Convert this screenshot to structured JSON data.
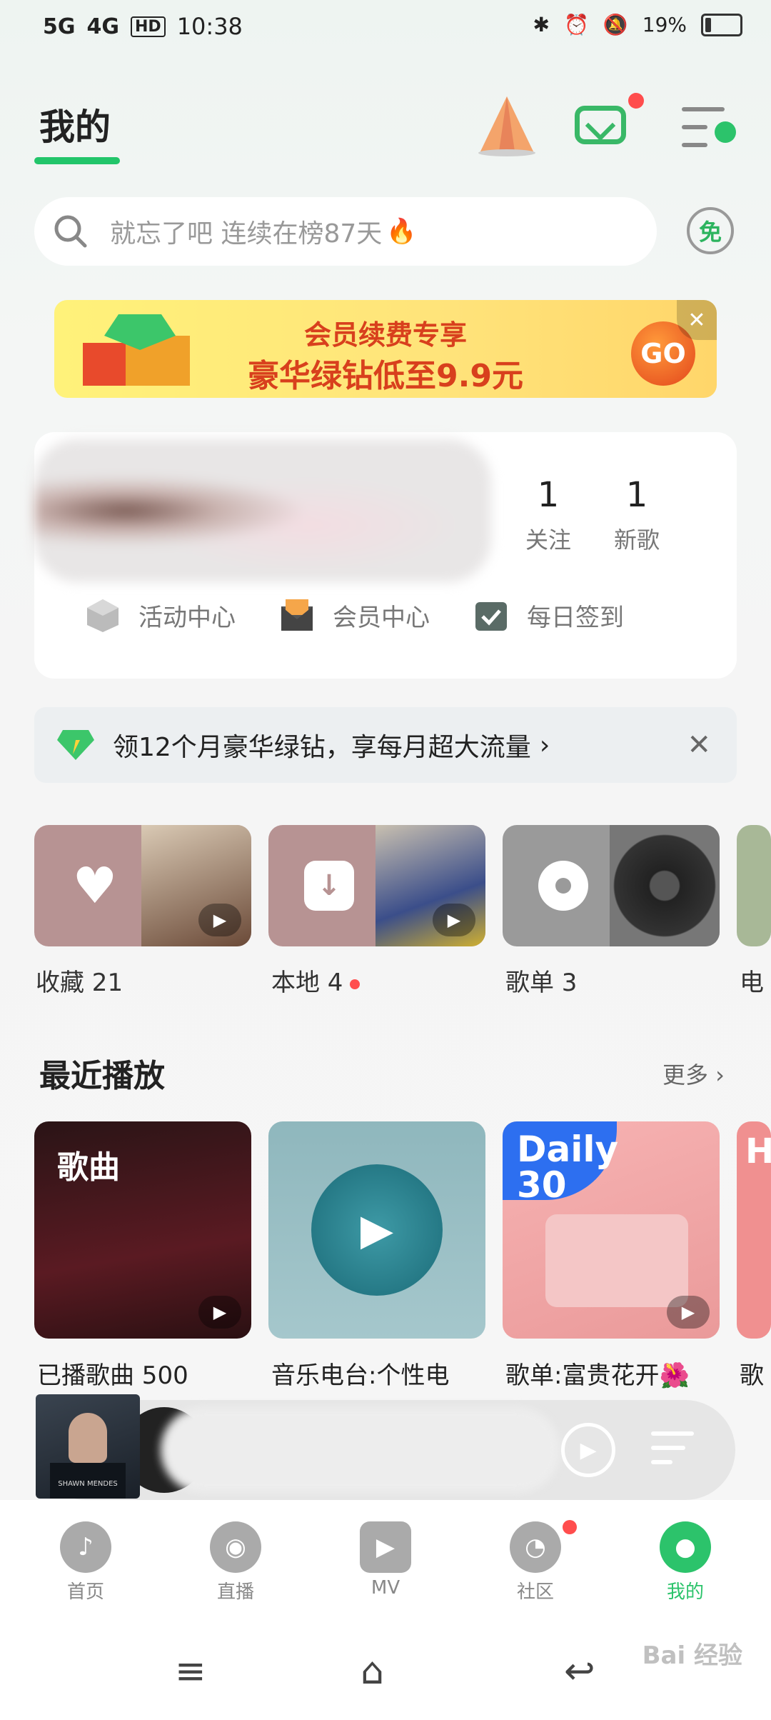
{
  "status_bar": {
    "network1": "5G",
    "network2": "4G",
    "hd": "HD",
    "time": "10:38",
    "battery": "19%",
    "battery_level": 0.19
  },
  "header": {
    "title": "我的"
  },
  "search": {
    "placeholder": "就忘了吧 连续在榜87天",
    "free_badge": "免"
  },
  "banner": {
    "line1": "会员续费专享",
    "line2": "豪华绿钻低至9.9元",
    "go": "GO",
    "close": "✕"
  },
  "profile": {
    "stats": [
      {
        "value": "1",
        "label": "关注"
      },
      {
        "value": "1",
        "label": "新歌"
      }
    ],
    "links": [
      {
        "label": "活动中心",
        "icon": "cube-icon"
      },
      {
        "label": "会员中心",
        "icon": "new-envelope-icon"
      },
      {
        "label": "每日签到",
        "icon": "calendar-check-icon"
      }
    ]
  },
  "promo": {
    "text": "领12个月豪华绿钻，享每月超大流量",
    "chevron": "›",
    "close": "✕"
  },
  "quick_tiles": [
    {
      "label": "收藏 21",
      "icon": "heart-icon",
      "color": "#b79393"
    },
    {
      "label": "本地 4",
      "icon": "download-icon",
      "color": "#b79393",
      "dot": true
    },
    {
      "label": "歌单 3",
      "icon": "disc-icon",
      "color": "#9a9a9a"
    },
    {
      "label": "电",
      "icon": "radio-icon",
      "color": "#a8b897"
    }
  ],
  "recent": {
    "title": "最近播放",
    "more": "更多 ›",
    "items": [
      {
        "label": "已播歌曲 500",
        "overlay": "歌曲"
      },
      {
        "label": "音乐电台:个性电",
        "overlay": ""
      },
      {
        "label": "歌单:富贵花开🌺",
        "overlay": "Daily 30"
      },
      {
        "label": "歌",
        "overlay": "H"
      }
    ]
  },
  "player": {
    "cover_text": "SHAWN MENDES"
  },
  "tabs": [
    {
      "label": "首页",
      "icon": "music-note-icon"
    },
    {
      "label": "直播",
      "icon": "eye-icon"
    },
    {
      "label": "MV",
      "icon": "play-icon"
    },
    {
      "label": "社区",
      "icon": "community-icon"
    },
    {
      "label": "我的",
      "icon": "person-icon"
    }
  ],
  "watermark": "Bai 经验"
}
